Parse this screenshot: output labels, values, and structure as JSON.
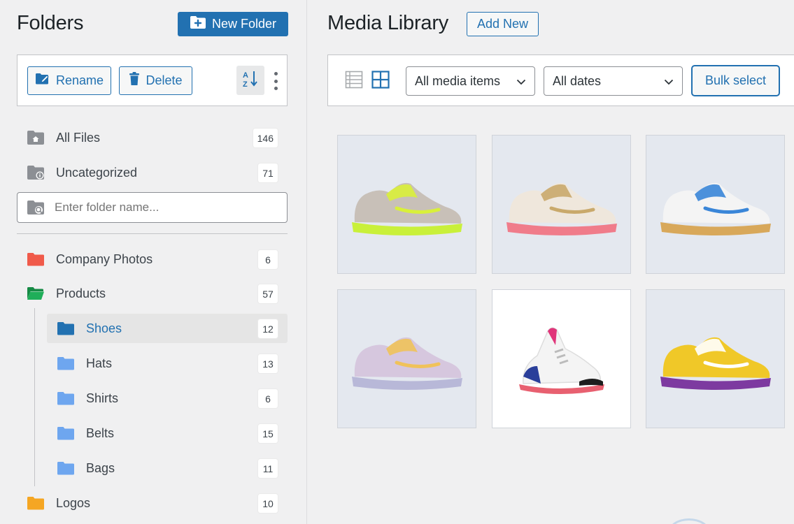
{
  "folders_panel": {
    "title": "Folders",
    "new_folder_label": "New Folder",
    "rename_label": "Rename",
    "delete_label": "Delete",
    "sort_icon": "sort-alpha-icon",
    "more_icon": "kebab-menu-icon",
    "search_placeholder": "Enter folder name...",
    "special": [
      {
        "label": "All Files",
        "count": "146",
        "icon": "home-folder-icon"
      },
      {
        "label": "Uncategorized",
        "count": "71",
        "icon": "info-folder-icon"
      }
    ],
    "folders": [
      {
        "label": "Company Photos",
        "count": "6",
        "color": "#f05a4a"
      },
      {
        "label": "Products",
        "count": "57",
        "color": "#1fae59",
        "open": true
      },
      {
        "label": "Shoes",
        "count": "12",
        "color": "#2271b1",
        "active": true
      },
      {
        "label": "Hats",
        "count": "13",
        "color": "#6ea6ef"
      },
      {
        "label": "Shirts",
        "count": "6",
        "color": "#6ea6ef"
      },
      {
        "label": "Belts",
        "count": "15",
        "color": "#6ea6ef"
      },
      {
        "label": "Bags",
        "count": "11",
        "color": "#6ea6ef"
      },
      {
        "label": "Logos",
        "count": "10",
        "color": "#f5a623"
      }
    ]
  },
  "media_panel": {
    "title": "Media Library",
    "add_new_label": "Add New",
    "view_icons": [
      "list-view-icon",
      "grid-view-icon"
    ],
    "media_filter": "All media items",
    "date_filter": "All dates",
    "bulk_select_label": "Bulk select",
    "items": [
      {
        "name": "sneaker-1",
        "upper": "#c8c0b8",
        "accent": "#d9f03a",
        "sole": "#c9f03a"
      },
      {
        "name": "sneaker-2",
        "upper": "#efe7dc",
        "accent": "#c9a96b",
        "sole": "#f07c8a"
      },
      {
        "name": "sneaker-3",
        "upper": "#f4f4f4",
        "accent": "#3a86d8",
        "sole": "#d8a85a"
      },
      {
        "name": "sneaker-4",
        "upper": "#d6c7de",
        "accent": "#f0c25a",
        "sole": "#b8b8d8"
      },
      {
        "name": "sneaker-5",
        "upper": "#f4f4f4",
        "accent": "#e0357a",
        "sole": "#e86070"
      },
      {
        "name": "sneaker-6",
        "upper": "#f0c828",
        "accent": "#ffffff",
        "sole": "#7d3aa0"
      }
    ]
  },
  "colors": {
    "accent": "#2271b1",
    "background": "#f0f0f1",
    "tile_bg": "#e4e8ef"
  }
}
